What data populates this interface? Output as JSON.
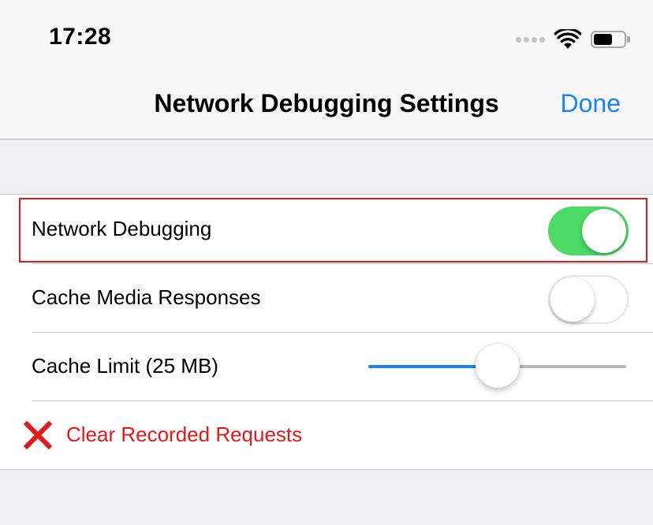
{
  "status_bar": {
    "time": "17:28",
    "battery_level": 0.62
  },
  "nav": {
    "title": "Network Debugging Settings",
    "done_label": "Done"
  },
  "settings": {
    "network_debugging": {
      "label": "Network Debugging",
      "enabled": true
    },
    "cache_media": {
      "label": "Cache Media Responses",
      "enabled": false
    },
    "cache_limit": {
      "label": "Cache Limit (25 MB)",
      "value_fraction": 0.5
    },
    "clear": {
      "label": "Clear Recorded Requests"
    }
  },
  "colors": {
    "accent": "#1a82fb",
    "toggle_on": "#4cd964",
    "destructive": "#e01a1a",
    "highlight_border": "#e01a1a"
  },
  "icons": {
    "clear": "x-mark-icon",
    "wifi": "wifi-icon",
    "battery": "battery-icon",
    "signal": "cellular-signal-icon"
  }
}
